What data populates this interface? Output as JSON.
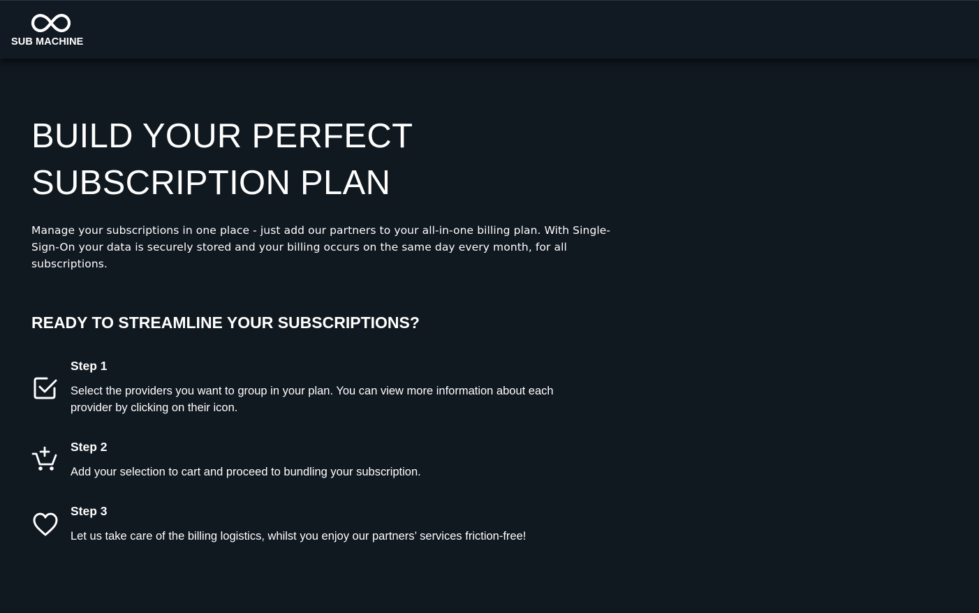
{
  "header": {
    "brand_name": "SUB MACHINE",
    "logo_icon": "infinity-icon"
  },
  "hero": {
    "title_line1": "BUILD YOUR PERFECT",
    "title_line2": "SUBSCRIPTION PLAN",
    "intro": "Manage your subscriptions in one place - just add our partners to your all-in-one billing plan. With Single-Sign-On your data is securely stored and your billing occurs on the same day every month, for all subscriptions."
  },
  "steps_section": {
    "heading": "READY TO STREAMLINE YOUR SUBSCRIPTIONS?",
    "steps": [
      {
        "title": "Step 1",
        "text": "Select the providers you want to group in your plan. You can view more information about each provider by clicking on their icon.",
        "icon": "checkbox-checked-icon"
      },
      {
        "title": "Step 2",
        "text": "Add your selection to cart and proceed to bundling your subscription.",
        "icon": "add-to-cart-icon"
      },
      {
        "title": "Step 3",
        "text": "Let us take care of the billing logistics, whilst you enjoy our partners’ services friction-free!",
        "icon": "heart-icon"
      }
    ]
  },
  "colors": {
    "background": "#101820",
    "header_background": "#111a22",
    "text": "#ffffff"
  }
}
